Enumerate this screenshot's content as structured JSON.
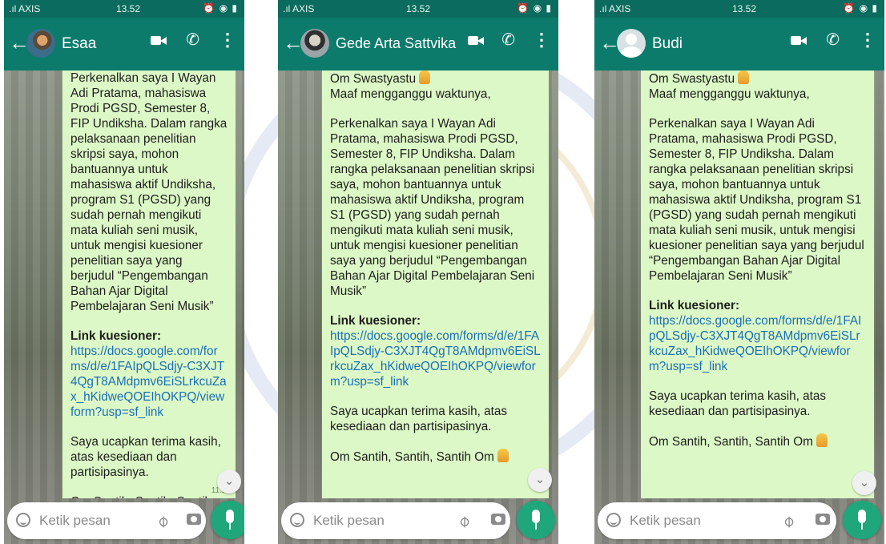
{
  "status_bar": {
    "carrier": ".ıl AXIS",
    "clock": "13.52",
    "icons": "⏰ ◉ ▮"
  },
  "message": {
    "greeting": "Om Swastyastu",
    "intro": "Maaf mengganggu waktunya,",
    "body": "Perkenalkan saya I Wayan Adi Pratama, mahasiswa Prodi PGSD, Semester 8, FIP Undiksha. Dalam rangka pelaksanaan penelitian skripsi saya, mohon bantuannya untuk mahasiswa aktif Undiksha, program S1 (PGSD) yang sudah pernah mengikuti mata kuliah seni musik, untuk mengisi kuesioner penelitian saya yang berjudul “Pengembangan Bahan Ajar Digital Pembelajaran Seni Musik”",
    "link_label": "Link kuesioner:",
    "link_url": "https://docs.google.com/forms/d/e/1FAIpQLSdjy-C3XJT4QgT8AMdpmv6EiSLrkcuZax_hKidweQOEIhOKPQ/viewform?usp=sf_link",
    "thanks": "Saya ucapkan terima kasih, atas kesediaan dan partisipasinya.",
    "closing": "Om Santih, Santih, Santih Om",
    "time": "11.21"
  },
  "input": {
    "placeholder": "Ketik pesan"
  },
  "chats": [
    {
      "contact": "Esaa",
      "avatar": "photo-avatar"
    },
    {
      "contact": "Gede Arta Sattvika",
      "avatar": "photo-avatar"
    },
    {
      "contact": "Budi",
      "avatar": "default-avatar"
    }
  ],
  "colors": {
    "header": "#0c7b6c",
    "status_bar": "#0a6b5e",
    "bubble": "#dcf8c6",
    "link": "#1a6fb8",
    "mic_button": "#1fa67a"
  },
  "icons": {
    "back": "arrow-left-icon",
    "video": "video-call-icon",
    "call": "phone-icon",
    "menu": "more-vert-icon",
    "emoji": "emoji-icon",
    "attach": "paperclip-icon",
    "camera": "camera-icon",
    "mic": "mic-icon",
    "scroll": "chevron-down-icon",
    "pray": "folded-hands-icon"
  }
}
